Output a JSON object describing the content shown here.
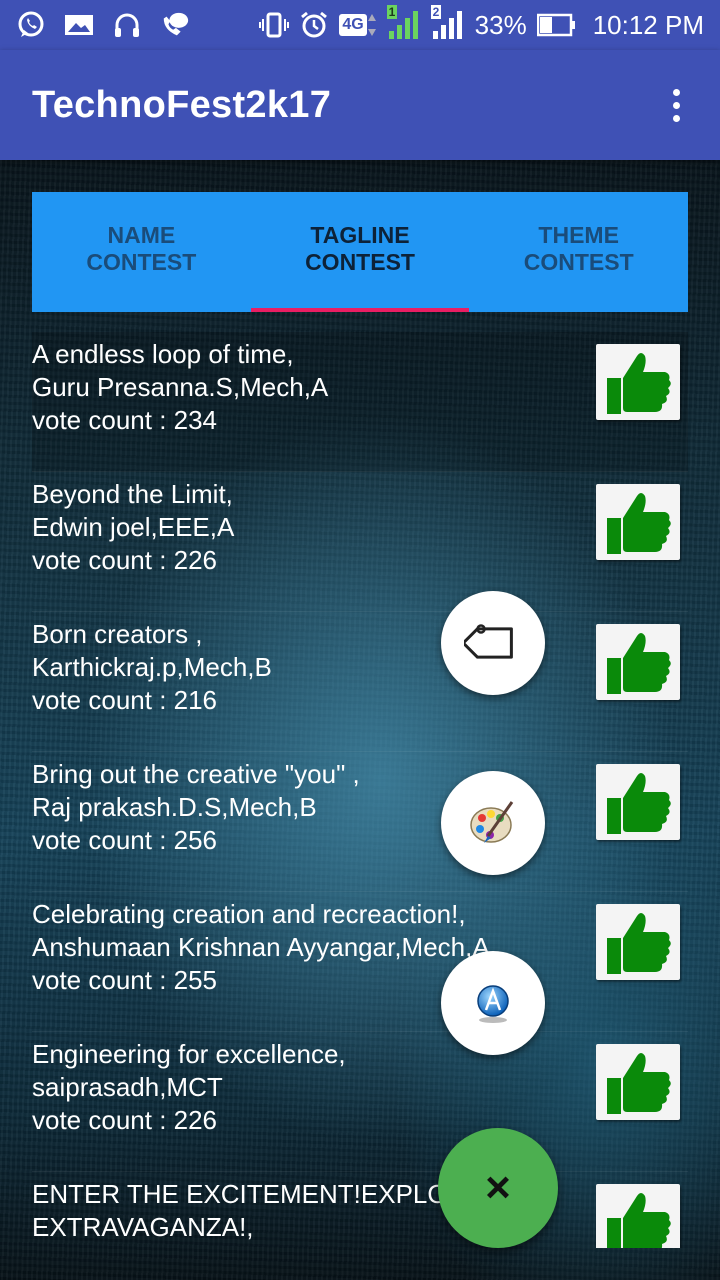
{
  "status_bar": {
    "battery": "33%",
    "time": "10:12 PM",
    "network": "4G",
    "sim1": "1",
    "sim2": "2"
  },
  "app_bar": {
    "title": "TechnoFest2k17"
  },
  "tabs": [
    {
      "label": "NAME\nCONTEST",
      "active": false
    },
    {
      "label": "TAGLINE\nCONTEST",
      "active": true
    },
    {
      "label": "THEME\nCONTEST",
      "active": false
    }
  ],
  "entries": [
    {
      "tagline": "A endless loop of time,",
      "author": "Guru Presanna.S,Mech,A",
      "votes": "vote count : 234"
    },
    {
      "tagline": "Beyond the Limit,",
      "author": "Edwin joel,EEE,A",
      "votes": "vote count : 226"
    },
    {
      "tagline": "Born creators ,",
      "author": "Karthickraj.p,Mech,B",
      "votes": "vote count : 216"
    },
    {
      "tagline": "Bring out the creative \"you\" ,",
      "author": "Raj prakash.D.S,Mech,B",
      "votes": "vote count : 256"
    },
    {
      "tagline": "Celebrating creation and recreaction!,",
      "author": "Anshumaan Krishnan Ayyangar,Mech,A",
      "votes": "vote count : 255"
    },
    {
      "tagline": "Engineering for excellence,",
      "author": "saiprasadh,MCT",
      "votes": "vote count : 226"
    },
    {
      "tagline": "ENTER THE EXCITEMENT!EXPLORE THE EXTRAVAGANZA!,",
      "author": "EXTRAVAGANZA!,",
      "votes": ""
    }
  ],
  "fab": {
    "tag_icon": "tag-icon",
    "palette_icon": "palette-icon",
    "font_icon": "font-a-icon",
    "close_label": "×"
  },
  "colors": {
    "primary": "#3f51b5",
    "tab_bar": "#2196f3",
    "indicator": "#e91e63",
    "fab": "#4caf50",
    "like": "#0a8a0a"
  }
}
